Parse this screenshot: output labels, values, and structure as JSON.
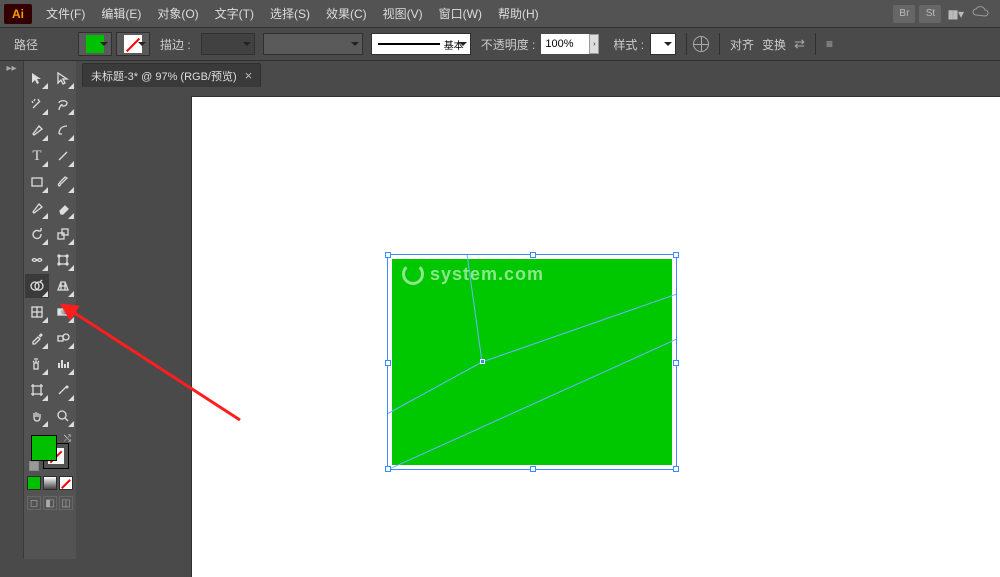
{
  "app": {
    "logo": "Ai"
  },
  "menu": {
    "file": "文件(F)",
    "edit": "编辑(E)",
    "object": "对象(O)",
    "text": "文字(T)",
    "select": "选择(S)",
    "effect": "效果(C)",
    "view": "视图(V)",
    "window": "窗口(W)",
    "help": "帮助(H)"
  },
  "menu_right": {
    "br": "Br",
    "st": "St"
  },
  "control": {
    "selection_type": "路径",
    "stroke_label": "描边 :",
    "stroke_weight": "",
    "brush_basic": "基本",
    "opacity_label": "不透明度 :",
    "opacity_value": "100%",
    "style_label": "样式 :",
    "align": "对齐",
    "transform": "变换"
  },
  "document": {
    "tab_title": "未标题-3* @ 97% (RGB/预览)"
  },
  "colors": {
    "fill": "#00c000",
    "stroke": "none"
  },
  "watermark": {
    "text": "system.com"
  }
}
